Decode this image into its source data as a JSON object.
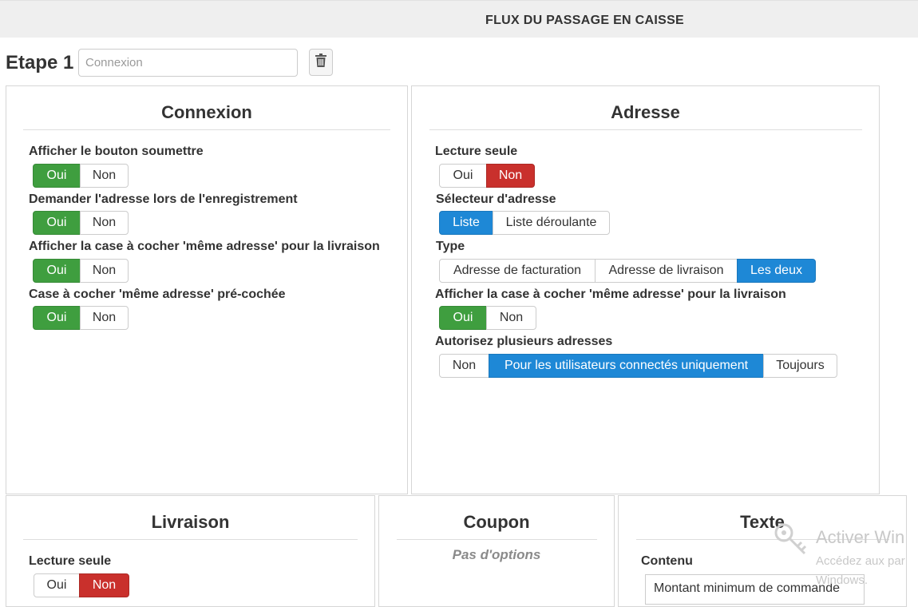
{
  "header": {
    "title": "FLUX DU PASSAGE EN CAISSE"
  },
  "step": {
    "label": "Etape 1",
    "name_placeholder": "Connexion",
    "delete_icon": "trash-icon"
  },
  "panels": {
    "connexion": {
      "title": "Connexion",
      "fields": [
        {
          "label": "Afficher le bouton soumettre",
          "options": [
            "Oui",
            "Non"
          ],
          "selected": "Oui"
        },
        {
          "label": "Demander l'adresse lors de l'enregistrement",
          "options": [
            "Oui",
            "Non"
          ],
          "selected": "Oui"
        },
        {
          "label": "Afficher la case à cocher 'même adresse' pour la livraison",
          "options": [
            "Oui",
            "Non"
          ],
          "selected": "Oui"
        },
        {
          "label": "Case à cocher 'même adresse' pré-cochée",
          "options": [
            "Oui",
            "Non"
          ],
          "selected": "Oui"
        }
      ]
    },
    "adresse": {
      "title": "Adresse",
      "fields": [
        {
          "label": "Lecture seule",
          "options": [
            "Oui",
            "Non"
          ],
          "selected": "Non"
        },
        {
          "label": "Sélecteur d'adresse",
          "options": [
            "Liste",
            "Liste déroulante"
          ],
          "selected": "Liste"
        },
        {
          "label": "Type",
          "options": [
            "Adresse de facturation",
            "Adresse de livraison",
            "Les deux"
          ],
          "selected": "Les deux"
        },
        {
          "label": "Afficher la case à cocher 'même adresse' pour la livraison",
          "options": [
            "Oui",
            "Non"
          ],
          "selected": "Oui"
        },
        {
          "label": "Autorisez plusieurs adresses",
          "options": [
            "Non",
            "Pour les utilisateurs connectés uniquement",
            "Toujours"
          ],
          "selected": "Pour les utilisateurs connectés uniquement"
        }
      ]
    },
    "livraison": {
      "title": "Livraison",
      "fields": [
        {
          "label": "Lecture seule",
          "options": [
            "Oui",
            "Non"
          ],
          "selected": "Non"
        }
      ]
    },
    "coupon": {
      "title": "Coupon",
      "empty_text": "Pas d'options"
    },
    "texte": {
      "title": "Texte",
      "content_label": "Contenu",
      "content_value": "Montant minimum de commande"
    }
  },
  "watermark": {
    "line1": "Activer Win",
    "line2": "Accédez aux par",
    "line3": "Windows."
  },
  "colors": {
    "yes_active": "#3f9e3f",
    "no_active": "#c9302c",
    "choice_active": "#1e88d6"
  }
}
